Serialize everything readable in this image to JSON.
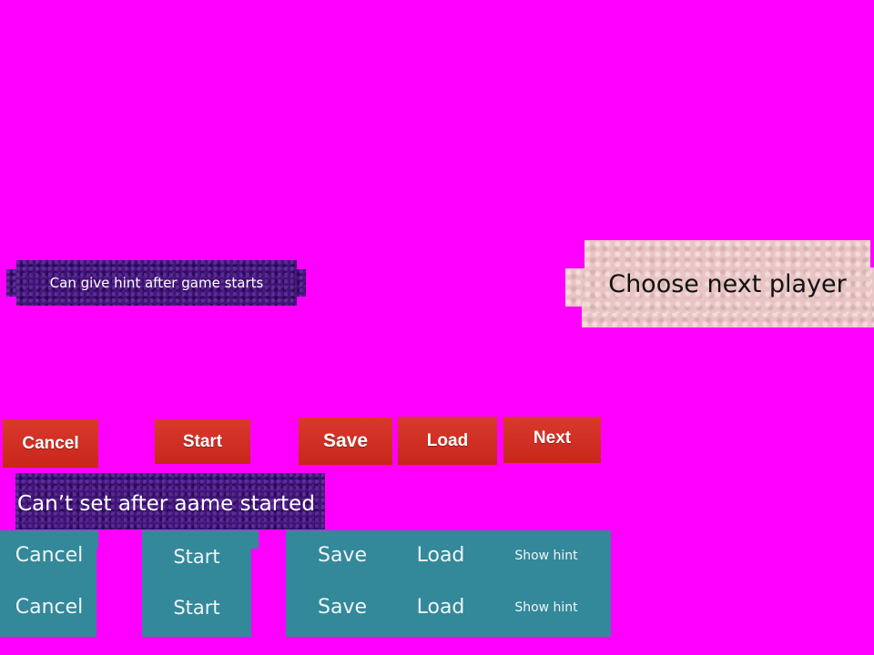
{
  "hint_note": "Can give hint after game starts",
  "choose_player_label": "Choose next player",
  "red_toolbar": {
    "cancel": "Cancel",
    "start": "Start",
    "save": "Save",
    "load": "Load",
    "next": "Next"
  },
  "set_note": "Can’t set after aame started",
  "teal_row_1": {
    "cancel": "Cancel",
    "start": "Start",
    "save": "Save",
    "load": "Load",
    "show_hint": "Show hint"
  },
  "teal_row_2": {
    "cancel": "Cancel",
    "start": "Start",
    "save": "Save",
    "load": "Load",
    "show_hint": "Show hint"
  },
  "colors": {
    "background": "#ff00ff",
    "purple_plate": "#3d1473",
    "pink_plate": "#e8c4c4",
    "red_button": "#d0301f",
    "teal_panel": "#33889a"
  }
}
